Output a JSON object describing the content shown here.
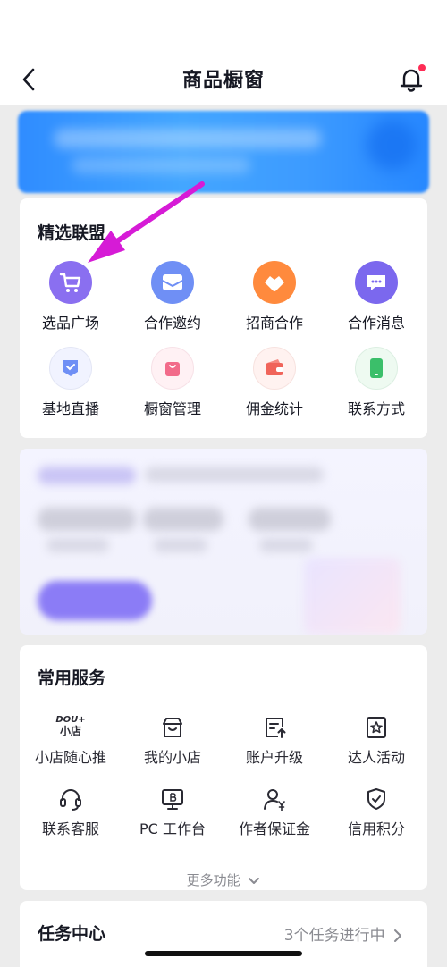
{
  "header": {
    "title": "商品橱窗"
  },
  "alliance": {
    "title": "精选联盟",
    "items": [
      {
        "label": "选品广场",
        "icon": "shopping-cart-icon",
        "color": "#8a6ff0"
      },
      {
        "label": "合作邀约",
        "icon": "envelope-icon",
        "color": "#6f8ff5"
      },
      {
        "label": "招商合作",
        "icon": "handshake-icon",
        "color": "#ff8a3d"
      },
      {
        "label": "合作消息",
        "icon": "chat-bubble-icon",
        "color": "#7b68ee"
      },
      {
        "label": "基地直播",
        "icon": "live-badge-icon",
        "color": "#6f8ff5"
      },
      {
        "label": "橱窗管理",
        "icon": "shopping-bag-icon",
        "color": "#f26b8a"
      },
      {
        "label": "佣金统计",
        "icon": "wallet-icon",
        "color": "#f0645a"
      },
      {
        "label": "联系方式",
        "icon": "phone-icon",
        "color": "#3bbf6a"
      }
    ]
  },
  "services": {
    "title": "常用服务",
    "items": [
      {
        "label": "小店随心推",
        "icon": "dou-plus-icon",
        "logo_top": "DOU+",
        "logo_bottom": "小店"
      },
      {
        "label": "我的小店",
        "icon": "store-icon"
      },
      {
        "label": "账户升级",
        "icon": "account-upgrade-icon"
      },
      {
        "label": "达人活动",
        "icon": "star-badge-icon"
      },
      {
        "label": "联系客服",
        "icon": "headset-icon"
      },
      {
        "label": "PC 工作台",
        "icon": "pc-monitor-icon"
      },
      {
        "label": "作者保证金",
        "icon": "user-deposit-icon"
      },
      {
        "label": "信用积分",
        "icon": "shield-check-icon"
      }
    ],
    "more_label": "更多功能"
  },
  "tasks": {
    "title": "任务中心",
    "status": "3个任务进行中"
  }
}
